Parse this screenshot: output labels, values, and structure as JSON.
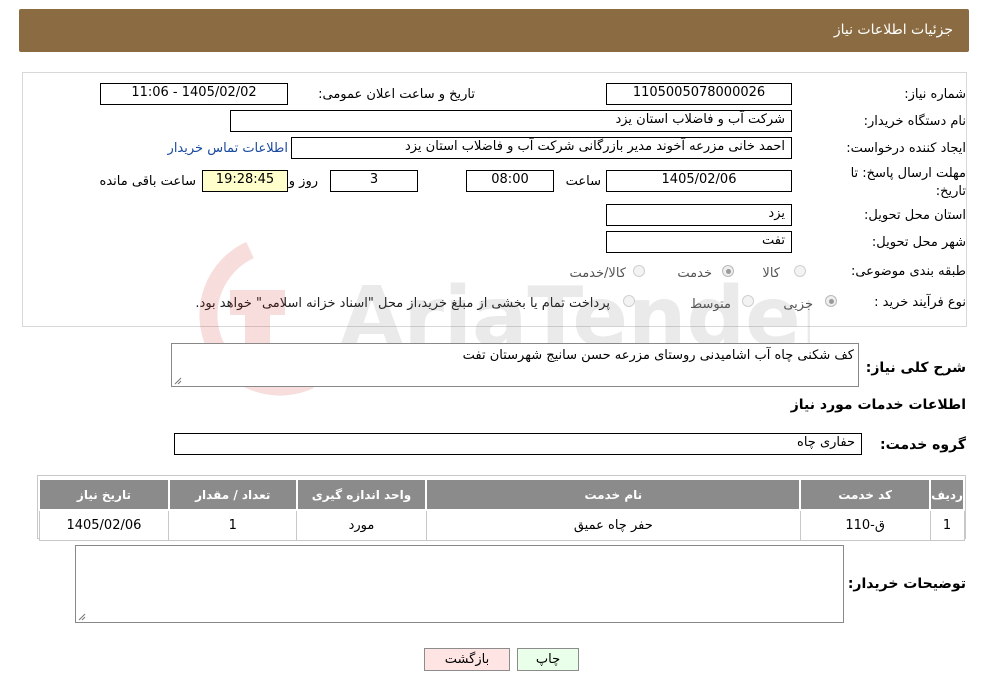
{
  "header": {
    "title": "جزئیات اطلاعات نیاز"
  },
  "form": {
    "need_number_label": "شماره نیاز:",
    "need_number": "1105005078000026",
    "announce_label": "تاریخ و ساعت اعلان عمومی:",
    "announce_value": "1405/02/02 - 11:06",
    "buyer_label": "نام دستگاه خریدار:",
    "buyer_value": "شرکت آب و فاضلاب استان یزد",
    "creator_label": "ایجاد کننده درخواست:",
    "creator_value": "احمد خانی مزرعه آخوند مدیر بازرگانی شرکت آب و فاضلاب استان یزد",
    "contact_link": "اطلاعات تماس خریدار",
    "deadline_label": "مهلت ارسال پاسخ: تا تاریخ:",
    "deadline_date": "1405/02/06",
    "time_label": "ساعت",
    "deadline_time": "08:00",
    "days_value": "3",
    "days_label": "روز و",
    "remaining_time": "19:28:45",
    "remaining_label": "ساعت باقی مانده",
    "province_label": "استان محل تحویل:",
    "province_value": "یزد",
    "city_label": "شهر محل تحویل:",
    "city_value": "تفت",
    "category_label": "طبقه بندی موضوعی:",
    "category_options": [
      "کالا",
      "خدمت",
      "کالا/خدمت"
    ],
    "category_selected": "خدمت",
    "process_label": "نوع فرآیند خرید :",
    "process_options": [
      "جزیی",
      "متوسط"
    ],
    "payment_note": "پرداخت تمام یا بخشی از مبلغ خرید،از محل \"اسناد خزانه اسلامی\" خواهد بود."
  },
  "description": {
    "label": "شرح کلی نیاز:",
    "value": "کف شکنی چاه آب اشامیدنی روستای مزرعه حسن سانیج شهرستان تفت"
  },
  "services": {
    "section_title": "اطلاعات خدمات مورد نیاز",
    "group_label": "گروه خدمت:",
    "group_value": "حفاری چاه",
    "columns": [
      "ردیف",
      "کد خدمت",
      "نام خدمت",
      "واحد اندازه گیری",
      "تعداد / مقدار",
      "تاریخ نیاز"
    ],
    "rows": [
      [
        "1",
        "ق-110",
        "حفر چاه عمیق",
        "مورد",
        "1",
        "1405/02/06"
      ]
    ]
  },
  "buyer_notes": {
    "label": "توضیحات خریدار:",
    "value": ""
  },
  "buttons": {
    "print": "چاپ",
    "back": "بازگشت"
  },
  "watermark": {
    "text": "AriaTender.neT"
  },
  "colors": {
    "header_bg": "#8b6b41",
    "table_header_bg": "#8b8b8b",
    "remaining_bg": "#ffffcc",
    "link": "#1a4a9e",
    "print_btn": "#eaffea",
    "back_btn": "#ffe4e4"
  }
}
